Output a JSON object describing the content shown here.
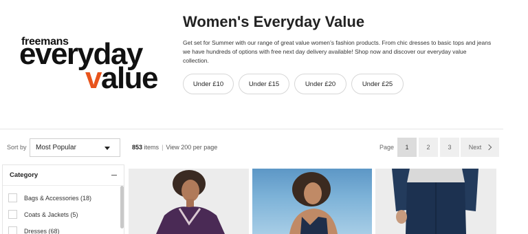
{
  "brand": {
    "line1": "freemans",
    "line2a": "everyday",
    "line3a": "v",
    "line3b": "alue"
  },
  "hero": {
    "title": "Women's Everyday Value",
    "description": "Get set for Summer with our range of great value women’s fashion products. From chic dresses to basic tops and jeans we have hundreds of options with free next day delivery available! Shop now and discover our everyday value collection.",
    "filters": [
      "Under £10",
      "Under £15",
      "Under £20",
      "Under £25"
    ]
  },
  "toolbar": {
    "sort_label": "Sort by",
    "sort_value": "Most Popular",
    "items_count": "853",
    "items_label": "items",
    "view_all": "View 200 per page",
    "page_label": "Page",
    "pages": [
      "1",
      "2",
      "3"
    ],
    "current_page": "1",
    "next_label": "Next"
  },
  "sidebar": {
    "category_title": "Category",
    "items": [
      "Bags & Accessories (18)",
      "Coats & Jackets (5)",
      "Dresses (68)"
    ]
  },
  "products": [
    {
      "image": "woman-purple-hoodie"
    },
    {
      "image": "woman-swimsuit-beach"
    },
    {
      "image": "woman-denim-jeans"
    }
  ],
  "colors": {
    "brand_orange": "#e8541c",
    "text_dark": "#222222",
    "page_btn_bg": "#efefef"
  },
  "icons": {
    "sort_caret": "chevron-down-icon",
    "collapse": "minus-icon",
    "next": "chevron-right-icon"
  }
}
